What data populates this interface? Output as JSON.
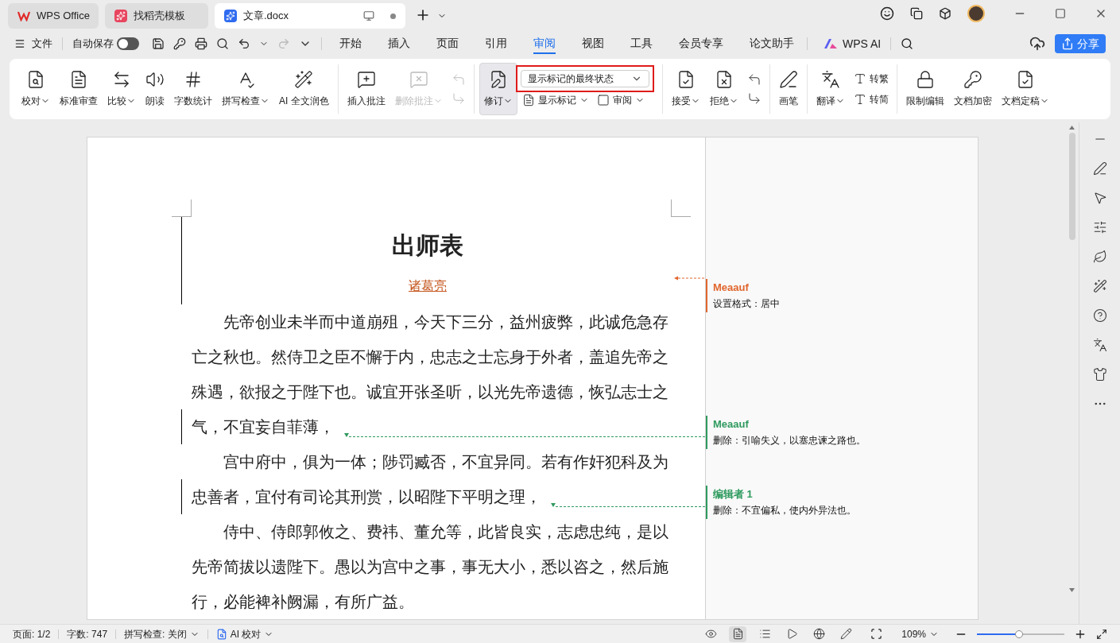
{
  "tabs": [
    {
      "label": "WPS Office",
      "selected": false
    },
    {
      "label": "找稻壳模板",
      "selected": false
    },
    {
      "label": "文章.docx",
      "selected": true
    }
  ],
  "menu": {
    "file": "文件",
    "autosave": {
      "label": "自动保存",
      "on": false
    },
    "tabs": [
      {
        "label": "开始",
        "selected": false
      },
      {
        "label": "插入",
        "selected": false
      },
      {
        "label": "页面",
        "selected": false
      },
      {
        "label": "引用",
        "selected": false
      },
      {
        "label": "审阅",
        "selected": true
      },
      {
        "label": "视图",
        "selected": false
      },
      {
        "label": "工具",
        "selected": false
      },
      {
        "label": "会员专享",
        "selected": false
      },
      {
        "label": "论文助手",
        "selected": false
      }
    ],
    "ai": "WPS AI",
    "share": "分享"
  },
  "ribbon": [
    {
      "items": [
        {
          "kind": "large",
          "label": "校对",
          "dropdown": true,
          "disabled": false,
          "on": false
        },
        {
          "kind": "large",
          "label": "标准审查",
          "dropdown": false,
          "disabled": false,
          "on": false
        },
        {
          "kind": "large",
          "label": "比较",
          "dropdown": true,
          "disabled": false,
          "on": false
        },
        {
          "kind": "large",
          "label": "朗读",
          "dropdown": false,
          "disabled": false,
          "on": false
        },
        {
          "kind": "large",
          "label": "字数统计",
          "dropdown": false,
          "disabled": false,
          "on": false
        },
        {
          "kind": "large",
          "label": "拼写检查",
          "dropdown": true,
          "disabled": false,
          "on": false
        },
        {
          "kind": "large",
          "label": "AI 全文润色",
          "dropdown": false,
          "disabled": false,
          "on": false
        }
      ]
    },
    {
      "items": [
        {
          "kind": "large",
          "label": "插入批注",
          "dropdown": false,
          "disabled": false,
          "on": false
        },
        {
          "kind": "large",
          "label": "删除批注",
          "dropdown": true,
          "disabled": true,
          "on": false
        },
        {
          "kind": "stack",
          "rows": [
            [
              {
                "kind": "icon",
                "disabled": true
              }
            ],
            [
              {
                "kind": "icon",
                "disabled": true
              }
            ]
          ]
        }
      ]
    },
    {
      "items": [
        {
          "kind": "large",
          "label": "修订",
          "dropdown": true,
          "disabled": false,
          "on": true
        },
        {
          "kind": "stack",
          "rows": [
            [
              {
                "kind": "select",
                "value": "显示标记的最终状态",
                "highlighted": true
              }
            ],
            [
              {
                "kind": "small",
                "label": "显示标记",
                "dropdown": true
              },
              {
                "kind": "small",
                "label": "审阅",
                "dropdown": true
              }
            ]
          ]
        }
      ]
    },
    {
      "items": [
        {
          "kind": "large",
          "label": "接受",
          "dropdown": true,
          "disabled": false,
          "on": false
        },
        {
          "kind": "large",
          "label": "拒绝",
          "dropdown": true,
          "disabled": false,
          "on": false
        },
        {
          "kind": "stack",
          "rows": [
            [
              {
                "kind": "icon",
                "disabled": false
              }
            ],
            [
              {
                "kind": "icon",
                "disabled": false
              }
            ]
          ]
        }
      ]
    },
    {
      "items": [
        {
          "kind": "large",
          "label": "画笔",
          "dropdown": false,
          "disabled": false,
          "on": false
        }
      ]
    },
    {
      "items": [
        {
          "kind": "large",
          "label": "翻译",
          "dropdown": true,
          "disabled": false,
          "on": false
        },
        {
          "kind": "stack",
          "rows": [
            [
              {
                "kind": "small",
                "label": "转繁",
                "dropdown": false
              }
            ],
            [
              {
                "kind": "small",
                "label": "转简",
                "dropdown": false
              }
            ]
          ]
        }
      ]
    },
    {
      "items": [
        {
          "kind": "large",
          "label": "限制编辑",
          "dropdown": false,
          "disabled": false,
          "on": false
        },
        {
          "kind": "large",
          "label": "文档加密",
          "dropdown": false,
          "disabled": false,
          "on": false
        },
        {
          "kind": "large",
          "label": "文档定稿",
          "dropdown": true,
          "disabled": false,
          "on": false
        }
      ]
    }
  ],
  "document": {
    "title": "出师表",
    "author": {
      "text": "诸葛亮",
      "changed": true
    },
    "comments": [
      {
        "author": "Meaauf",
        "text": "设置格式：居中",
        "color": "#e0662e"
      },
      {
        "author": "Meaauf",
        "text": "删除：引喻失义，以塞忠谏之路也。",
        "color": "#2e9a5e"
      },
      {
        "author": "编辑者 1",
        "text": "删除：不宜偏私，使内外异法也。",
        "color": "#2e9a5e"
      }
    ],
    "paragraphs": [
      {
        "lines": [
          {
            "text": "先帝创业未半而中道崩殂，今天下三分，益州疲弊，此诚危急存",
            "changed": false,
            "deletion": false
          },
          {
            "text": "亡之秋也。然侍卫之臣不懈于内，忠志之士忘身于外者，盖追先帝之",
            "changed": false,
            "deletion": false
          },
          {
            "text": "殊遇，欲报之于陛下也。诚宜开张圣听，以光先帝遗德，恢弘志士之",
            "changed": false,
            "deletion": false
          },
          {
            "text": "气，不宜妄自菲薄，",
            "changed": true,
            "deletion": true
          }
        ]
      },
      {
        "lines": [
          {
            "text": "宫中府中，俱为一体；陟罚臧否，不宜异同。若有作奸犯科及为",
            "changed": false,
            "deletion": false
          },
          {
            "text": "忠善者，宜付有司论其刑赏，以昭陛下平明之理，",
            "changed": true,
            "deletion": true
          }
        ]
      },
      {
        "lines": [
          {
            "text": "侍中、侍郎郭攸之、费祎、董允等，此皆良实，志虑忠纯，是以",
            "changed": false,
            "deletion": false
          },
          {
            "text": "先帝简拔以遗陛下。愚以为宫中之事，事无大小，悉以咨之，然后施",
            "changed": false,
            "deletion": false
          },
          {
            "text": "行，必能裨补阙漏，有所广益。",
            "changed": false,
            "deletion": false
          }
        ]
      }
    ]
  },
  "status": {
    "items": [
      {
        "label": "页面: 1/2",
        "dropdown": false
      },
      {
        "label": "字数: 747",
        "dropdown": false
      },
      {
        "label": "拼写检查: 关闭",
        "dropdown": true
      },
      {
        "label": "AI 校对",
        "dropdown": true
      }
    ],
    "views": [
      {
        "selected": false
      },
      {
        "selected": true
      },
      {
        "selected": false
      },
      {
        "selected": false
      },
      {
        "selected": false
      },
      {
        "selected": false
      }
    ],
    "zoom": {
      "value": "109%",
      "level": 0.48
    }
  }
}
